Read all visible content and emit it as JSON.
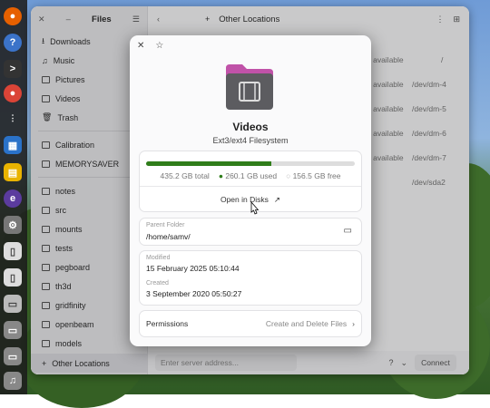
{
  "sidebar": {
    "title": "Files",
    "items": [
      {
        "label": "Downloads"
      },
      {
        "label": "Music"
      },
      {
        "label": "Pictures"
      },
      {
        "label": "Videos"
      },
      {
        "label": "Trash"
      }
    ],
    "devices": [
      {
        "label": "Calibration"
      },
      {
        "label": "MEMORYSAVER"
      }
    ],
    "bookmarks": [
      {
        "label": "notes"
      },
      {
        "label": "src"
      },
      {
        "label": "mounts"
      },
      {
        "label": "tests"
      },
      {
        "label": "pegboard"
      },
      {
        "label": "th3d"
      },
      {
        "label": "gridfinity"
      },
      {
        "label": "openbeam"
      },
      {
        "label": "models"
      }
    ],
    "other_locations": "Other Locations"
  },
  "header": {
    "title": "Other Locations"
  },
  "rows": [
    {
      "available": "3 available",
      "device": "/"
    },
    {
      "available": "3 available",
      "device": "/dev/dm-4"
    },
    {
      "available": "3 available",
      "device": "/dev/dm-5"
    },
    {
      "available": "3 available",
      "device": "/dev/dm-6"
    },
    {
      "available": "3 available",
      "device": "/dev/dm-7"
    },
    {
      "available": "",
      "device": "/dev/sda2"
    }
  ],
  "bottom": {
    "server_placeholder": "Enter server address...",
    "connect_label": "Connect"
  },
  "dialog": {
    "name": "Videos",
    "filesystem": "Ext3/ext4 Filesystem",
    "usage": {
      "total": "435.2 GB total",
      "used": "260.1 GB used",
      "free": "156.5 GB free",
      "used_fraction": 0.6
    },
    "open_in_disks": "Open in Disks",
    "parent_folder_label": "Parent Folder",
    "parent_folder": "/home/samv/",
    "modified_label": "Modified",
    "modified": "15 February 2025 05:10:44",
    "created_label": "Created",
    "created": "3 September 2020 05:50:27",
    "permissions_label": "Permissions",
    "permissions_value": "Create and Delete Files"
  },
  "colors": {
    "usage_bar": "#2f7d1a",
    "folder": "#c052a8"
  }
}
